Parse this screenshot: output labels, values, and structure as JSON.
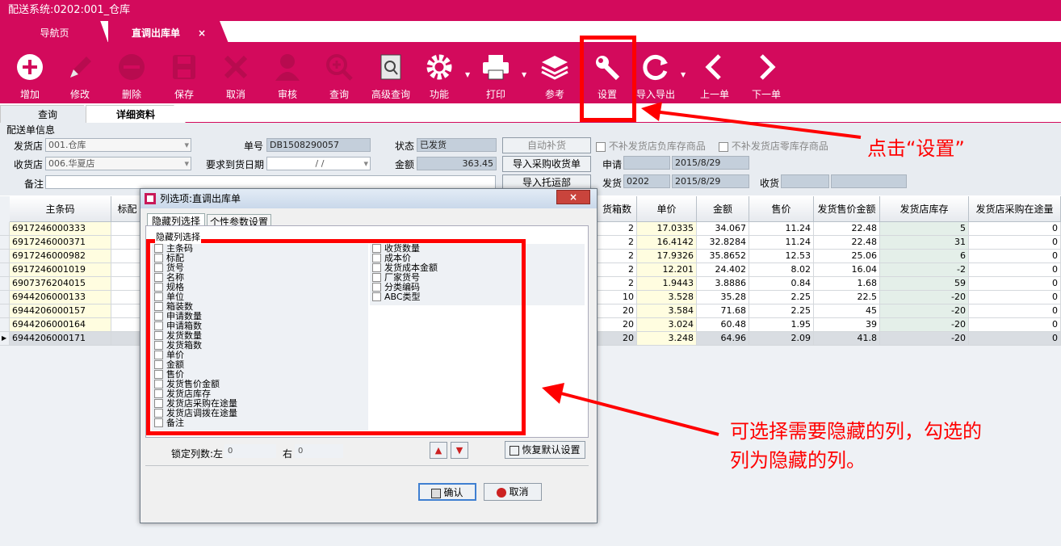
{
  "window": {
    "title": "配送系统:0202:001_仓库"
  },
  "tabs": [
    {
      "label": "导航页"
    },
    {
      "label": "直调出库单",
      "close": "×"
    }
  ],
  "toolbar": {
    "buttons": [
      "增加",
      "修改",
      "删除",
      "保存",
      "取消",
      "审核",
      "查询",
      "高级查询",
      "功能",
      "打印",
      "参考",
      "设置",
      "导入导出",
      "上一单",
      "下一单"
    ]
  },
  "subtabs": [
    "查询",
    "详细资料"
  ],
  "form": {
    "section_title": "配送单信息",
    "from_store_label": "发货店",
    "from_store": "001.仓库",
    "to_store_label": "收货店",
    "to_store": "006.华夏店",
    "note_label": "备注",
    "order_no_label": "单号",
    "order_no": "DB1508290057",
    "arrival_date_label": "要求到货日期",
    "arrival_date": "/ /",
    "status_label": "状态",
    "status": "已发货",
    "amount_label": "金额",
    "amount": "363.45",
    "auto_restock": "自动补货",
    "import_purchase": "导入采购收货单",
    "import_consign": "导入托运部",
    "chk1": "不补发货店负库存商品",
    "chk2": "不补发货店零库存商品",
    "apply_label": "申请",
    "apply_date": "2015/8/29",
    "ship_label": "发货",
    "ship_user": "0202",
    "ship_date": "2015/8/29",
    "recv_label": "收货"
  },
  "grid": {
    "headers": [
      "主条码",
      "标配",
      "货箱数",
      "单价",
      "金额",
      "售价",
      "发货售价金额",
      "发货店库存",
      "发货店采购在途量"
    ],
    "rows": [
      {
        "barcode": "6917246000333",
        "boxes": "2",
        "price": "17.0335",
        "amount": "34.067",
        "sale": "11.24",
        "sale_amt": "22.48",
        "stock": "5",
        "transit": "0"
      },
      {
        "barcode": "6917246000371",
        "boxes": "2",
        "price": "16.4142",
        "amount": "32.8284",
        "sale": "11.24",
        "sale_amt": "22.48",
        "stock": "31",
        "transit": "0"
      },
      {
        "barcode": "6917246000982",
        "boxes": "2",
        "price": "17.9326",
        "amount": "35.8652",
        "sale": "12.53",
        "sale_amt": "25.06",
        "stock": "6",
        "transit": "0"
      },
      {
        "barcode": "6917246001019",
        "boxes": "2",
        "price": "12.201",
        "amount": "24.402",
        "sale": "8.02",
        "sale_amt": "16.04",
        "stock": "-2",
        "transit": "0"
      },
      {
        "barcode": "6907376204015",
        "boxes": "2",
        "price": "1.9443",
        "amount": "3.8886",
        "sale": "0.84",
        "sale_amt": "1.68",
        "stock": "59",
        "transit": "0"
      },
      {
        "barcode": "6944206000133",
        "boxes": "10",
        "price": "3.528",
        "amount": "35.28",
        "sale": "2.25",
        "sale_amt": "22.5",
        "stock": "-20",
        "transit": "0"
      },
      {
        "barcode": "6944206000157",
        "boxes": "20",
        "price": "3.584",
        "amount": "71.68",
        "sale": "2.25",
        "sale_amt": "45",
        "stock": "-20",
        "transit": "0"
      },
      {
        "barcode": "6944206000164",
        "boxes": "20",
        "price": "3.024",
        "amount": "60.48",
        "sale": "1.95",
        "sale_amt": "39",
        "stock": "-20",
        "transit": "0"
      },
      {
        "barcode": "6944206000171",
        "boxes": "20",
        "price": "3.248",
        "amount": "64.96",
        "sale": "2.09",
        "sale_amt": "41.8",
        "stock": "-20",
        "transit": "0"
      }
    ]
  },
  "dialog": {
    "title": "列选项:直调出库单",
    "close": "×",
    "tabs": [
      "隐藏列选择",
      "个性参数设置"
    ],
    "group_label": "隐藏列选择",
    "left_items": [
      "主条码",
      "标配",
      "货号",
      "名称",
      "规格",
      "单位",
      "箱装数",
      "申请数量",
      "申请箱数",
      "发货数量",
      "发货箱数",
      "单价",
      "金额",
      "售价",
      "发货售价金额",
      "发货店库存",
      "发货店采购在途量",
      "发货店调拨在途量",
      "备注"
    ],
    "right_items": [
      "收货数量",
      "成本价",
      "发货成本金额",
      "厂家货号",
      "分类编码",
      "ABC类型"
    ],
    "lock_label": "锁定列数:左",
    "lock_left": "0",
    "lock_right_label": "右",
    "lock_right": "0",
    "up": "▲",
    "down": "▼",
    "restore": "恢复默认设置",
    "ok": "确认",
    "cancel": "取消"
  },
  "annotations": {
    "note1": "点击“设置”",
    "note2_line1": "可选择需要隐藏的列，勾选的",
    "note2_line2": "列为隐藏的列。"
  },
  "colors": {
    "brand": "#d30a5c",
    "annotation": "#ff0000",
    "grid_highlight": "#fffde0",
    "grid_stock": "#e4efe9"
  }
}
